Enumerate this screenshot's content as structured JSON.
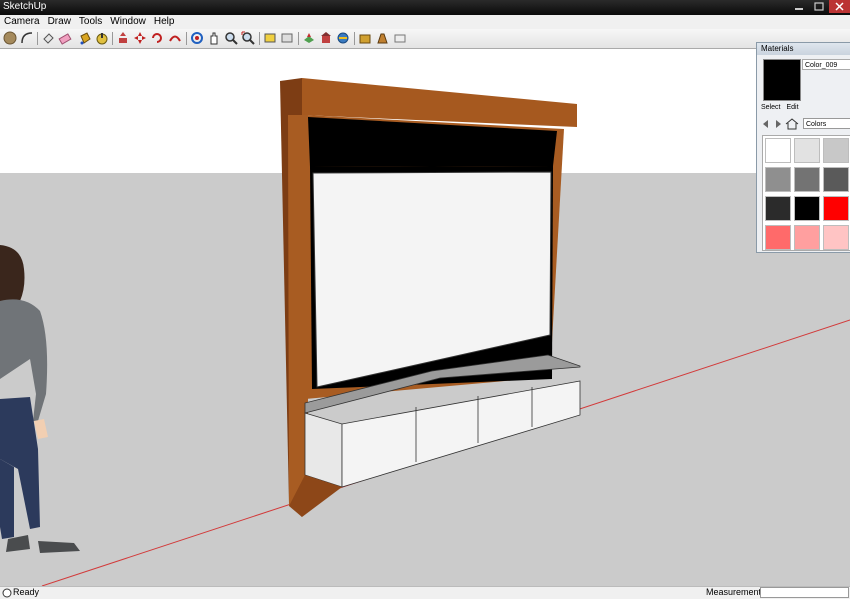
{
  "app": {
    "title": "SketchUp"
  },
  "menu": {
    "items": [
      "Camera",
      "Draw",
      "Tools",
      "Window",
      "Help"
    ]
  },
  "toolbar": {
    "tools": [
      "circle-tool-icon",
      "arc-tool-icon",
      "eraser-icon",
      "paint-bucket-icon",
      "tape-measure-icon",
      "protractor-icon",
      "push-pull-icon",
      "move-icon",
      "rotate-icon",
      "follow-me-icon",
      "orbit-icon",
      "pan-icon",
      "zoom-icon",
      "zoom-extents-icon",
      "section-icon",
      "component-icon",
      "photo-icon",
      "layers-icon",
      "warehouse-icon",
      "share-icon",
      "extension-icon",
      "style-icon"
    ]
  },
  "materials": {
    "panel_title": "Materials",
    "current_name": "Color_009",
    "current_color": "#000000",
    "tab_select": "Select",
    "tab_edit": "Edit",
    "library": "Colors",
    "swatches": [
      "#ffffff",
      "#e2e2e2",
      "#c8c8c8",
      "#8f8f8f",
      "#737373",
      "#5a5a5a",
      "#2b2b2b",
      "#000000",
      "#ff0000",
      "#ff6a6a",
      "#ff9f9f",
      "#ffc4c4"
    ]
  },
  "status": {
    "left": "Ready",
    "right": "Measurements"
  }
}
